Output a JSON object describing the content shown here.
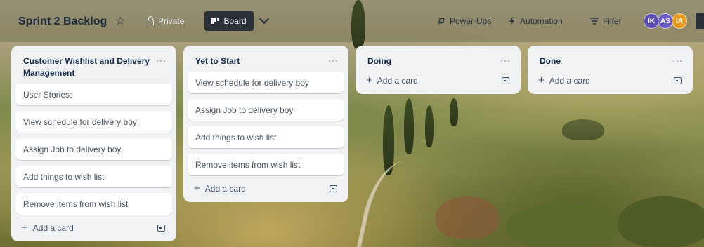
{
  "board": {
    "title": "Sprint 2 Backlog",
    "star_icon": "☆",
    "visibility": "Private",
    "view_button": "Board"
  },
  "toolbar": {
    "powerups": "Power-Ups",
    "automation": "Automation",
    "filter": "Filter"
  },
  "members": [
    {
      "initials": "IK",
      "color": "#5e4db2"
    },
    {
      "initials": "AS",
      "color": "#6e5dc6"
    },
    {
      "initials": "IA",
      "color": "#e79c1b"
    }
  ],
  "lists": [
    {
      "title": "Customer Wishlist and Delivery Management",
      "menu": "···",
      "cards": [
        "User Stories:",
        "View schedule for delivery boy",
        "Assign Job to delivery boy",
        "Add things to wish list",
        "Remove items from wish list"
      ],
      "add_label": "Add a card"
    },
    {
      "title": "Yet to Start",
      "menu": "···",
      "cards": [
        "View schedule for delivery boy",
        "Assign Job to delivery boy",
        "Add things to wish list",
        "Remove items from wish list"
      ],
      "add_label": "Add a card"
    },
    {
      "title": "Doing",
      "menu": "···",
      "cards": [],
      "add_label": "Add a card"
    },
    {
      "title": "Done",
      "menu": "···",
      "cards": [],
      "add_label": "Add a card"
    }
  ]
}
